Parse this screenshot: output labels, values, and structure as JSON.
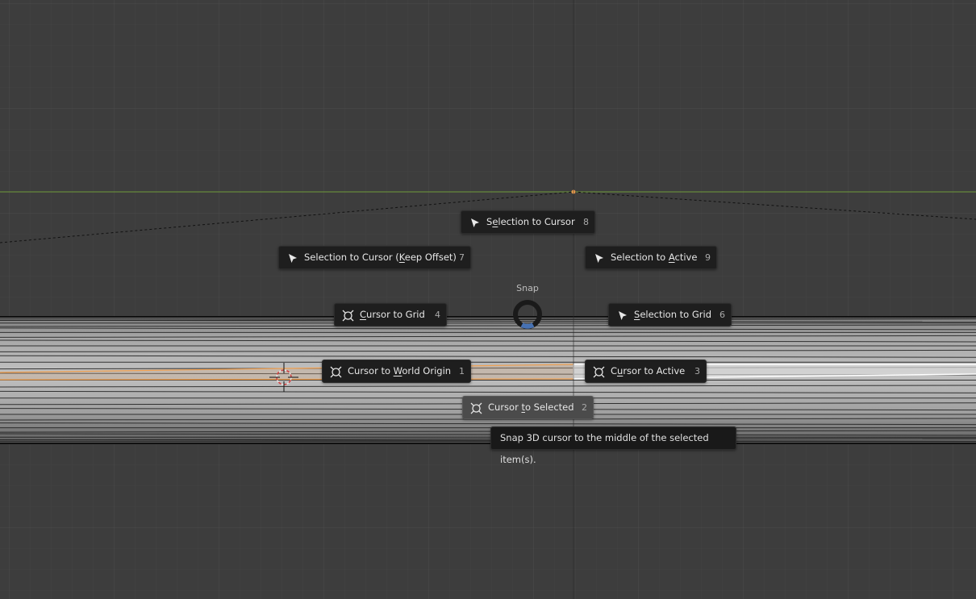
{
  "pie_menu": {
    "title": "Snap",
    "items": {
      "selection_to_cursor": {
        "label_pre": "S",
        "label_u": "e",
        "label_post": "lection to Cursor",
        "key": "8",
        "icon": "cursor-arrow-icon"
      },
      "selection_to_cursor_keep_offset": {
        "label_pre": "Selection to Cursor (",
        "label_u": "K",
        "label_post": "eep Offset)",
        "key": "7",
        "icon": "cursor-arrow-icon"
      },
      "selection_to_active": {
        "label_pre": "Selection to ",
        "label_u": "A",
        "label_post": "ctive",
        "key": "9",
        "icon": "cursor-arrow-icon"
      },
      "cursor_to_grid": {
        "label_pre": "",
        "label_u": "C",
        "label_post": "ursor to Grid",
        "key": "4",
        "icon": "3d-cursor-icon"
      },
      "selection_to_grid": {
        "label_pre": "",
        "label_u": "S",
        "label_post": "election to Grid",
        "key": "6",
        "icon": "cursor-arrow-icon"
      },
      "cursor_to_world_origin": {
        "label_pre": "Cursor to ",
        "label_u": "W",
        "label_post": "orld Origin",
        "key": "1",
        "icon": "3d-cursor-icon"
      },
      "cursor_to_active": {
        "label_pre": "C",
        "label_u": "u",
        "label_post": "rsor to Active",
        "key": "3",
        "icon": "3d-cursor-icon"
      },
      "cursor_to_selected": {
        "label_pre": "Cursor ",
        "label_u": "t",
        "label_post": "o Selected",
        "key": "2",
        "icon": "3d-cursor-icon"
      }
    },
    "highlighted_item": "cursor_to_selected"
  },
  "tooltip": {
    "text": "Snap 3D cursor to the middle of the selected item(s)."
  },
  "colors": {
    "background": "#3d3d3d",
    "grid_line": "#454545",
    "x_axis_green": "#6f9a3a",
    "selection_orange": "#f0a050",
    "pie_ring_accent": "#4772b3",
    "menu_item_bg": "#1e1e1e",
    "menu_item_active_bg": "#4b4b4b"
  }
}
